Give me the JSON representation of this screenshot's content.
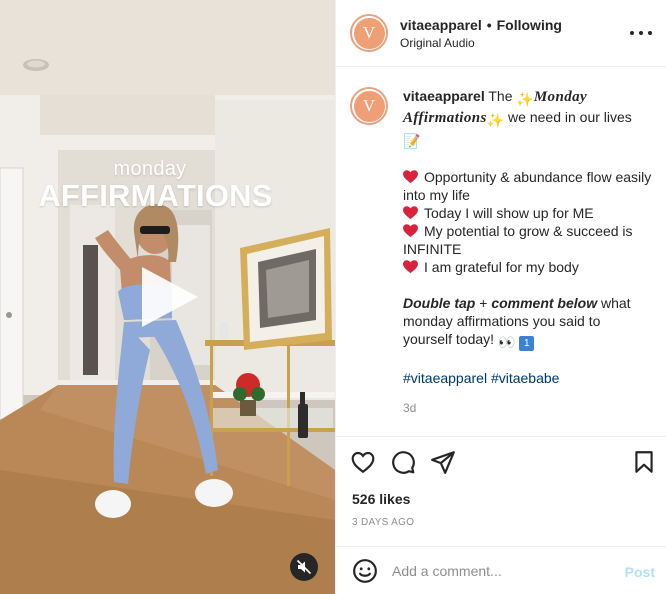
{
  "media": {
    "overlay_line1": "monday",
    "overlay_line2": "AFFIRMATIONS"
  },
  "header": {
    "username": "vitaeapparel",
    "separator": "•",
    "follow_status": "Following",
    "audio": "Original Audio",
    "avatar_letter": "V"
  },
  "caption": {
    "username": "vitaeapparel",
    "intro": "The",
    "sparkle_emoji": "✨",
    "title": "Monday Affirmations",
    "tail": "we need in our lives",
    "memo_emoji": "📝",
    "affirmations": [
      "Opportunity & abundance flow easily into my life",
      "Today I will show up for ME",
      "My potential to grow & succeed is INFINITE",
      "I am grateful for my body"
    ],
    "cta_double_tap": "Double tap",
    "cta_plus": "+",
    "cta_comment": "comment below",
    "cta_rest": "what monday affirmations you said to yourself today!",
    "cta_emojis": "👀",
    "cta_one": "1",
    "hashtags": [
      "#vitaeapparel",
      "#vitaebabe"
    ],
    "age": "3d"
  },
  "stats": {
    "likes": "526 likes",
    "date": "3 DAYS AGO"
  },
  "comment": {
    "placeholder": "Add a comment...",
    "post_label": "Post"
  },
  "colors": {
    "avatar_fill": "#ef9f75",
    "heart": "#d8233c",
    "hashtag": "#00376b",
    "post_disabled": "#b2dffc",
    "media_sleeve": "#8fa9d8"
  },
  "icons": [
    "play-icon",
    "mute-icon",
    "more-icon",
    "heart-icon",
    "comment-icon",
    "share-icon",
    "bookmark-icon",
    "emoji-icon"
  ]
}
